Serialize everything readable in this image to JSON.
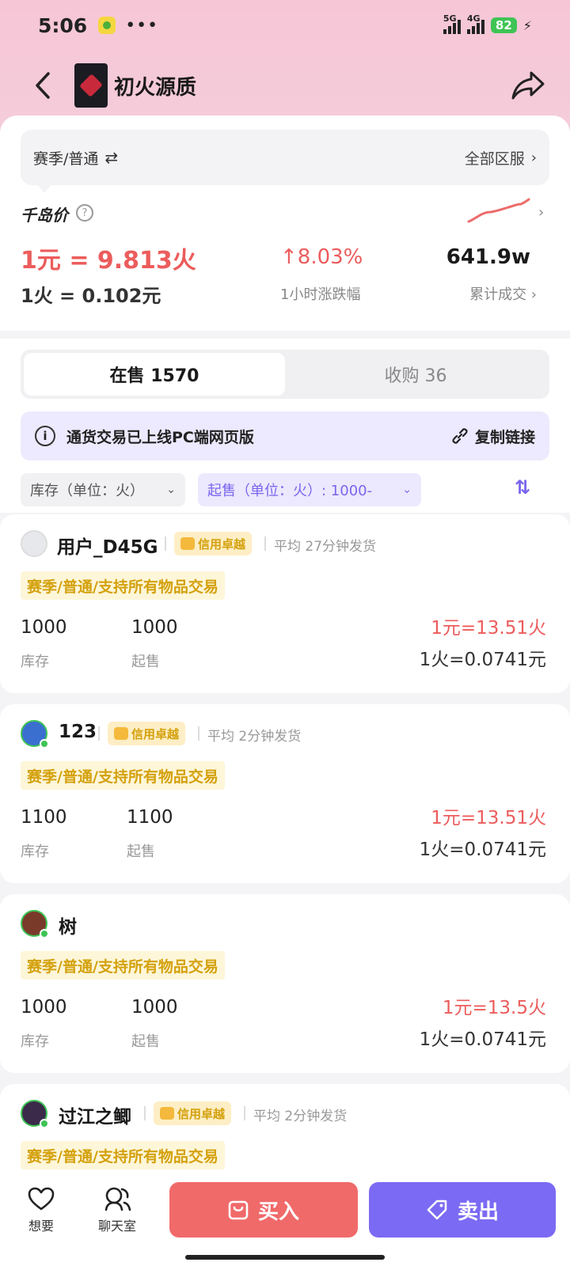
{
  "status": {
    "time": "5:06",
    "more": "•••",
    "sig1": "5G",
    "sig2": "4G",
    "battery": "82",
    "bolt": "⚡"
  },
  "header": {
    "title": "初火源质"
  },
  "filter": {
    "left": "赛季/普通",
    "swap": "⇄",
    "right": "全部区服",
    "chev": "›"
  },
  "price": {
    "label": "千岛价",
    "help": "?",
    "spark_chev": "›",
    "rate_main": "1元 = 9.813火",
    "rate_sub": "1火 = 0.102元",
    "change": "↑8.03%",
    "change_label": "1小时涨跌幅",
    "volume": "641.9w",
    "volume_label": "累计成交 ›"
  },
  "tabs": {
    "on_sale": "在售 1570",
    "buying": "收购 36"
  },
  "notice": {
    "icon": "i",
    "text": "通货交易已上线PC端网页版",
    "copy": "复制链接"
  },
  "selectors": {
    "stock": "库存（单位：火）",
    "min": "起售（单位：火）: 1000-",
    "arrow": "⌄",
    "sort": "⇅"
  },
  "listings": [
    {
      "name": "用户_D45G",
      "badge": "信用卓越",
      "ship": "平均 27分钟发货",
      "tag": "赛季/普通/支持所有物品交易",
      "stock": "1000",
      "stock_label": "库存",
      "min": "1000",
      "min_label": "起售",
      "rate1": "1元=13.51火",
      "rate2": "1火=0.0741元"
    },
    {
      "name": "123",
      "badge": "信用卓越",
      "ship": "平均 2分钟发货",
      "tag": "赛季/普通/支持所有物品交易",
      "stock": "1100",
      "stock_label": "库存",
      "min": "1100",
      "min_label": "起售",
      "rate1": "1元=13.51火",
      "rate2": "1火=0.0741元"
    },
    {
      "name": "树",
      "tag": "赛季/普通/支持所有物品交易",
      "stock": "1000",
      "stock_label": "库存",
      "min": "1000",
      "min_label": "起售",
      "rate1": "1元=13.5火",
      "rate2": "1火=0.0741元"
    },
    {
      "name": "过江之鲫",
      "badge": "信用卓越",
      "ship": "平均 2分钟发货",
      "tag": "赛季/普通/支持所有物品交易"
    }
  ],
  "bottom": {
    "want": "想要",
    "chat": "聊天室",
    "buy": "买入",
    "sell": "卖出"
  },
  "colors": {
    "accent_red": "#ec5c5c",
    "accent_purple": "#7b6af3",
    "header_pink": "#f6c6d6"
  }
}
